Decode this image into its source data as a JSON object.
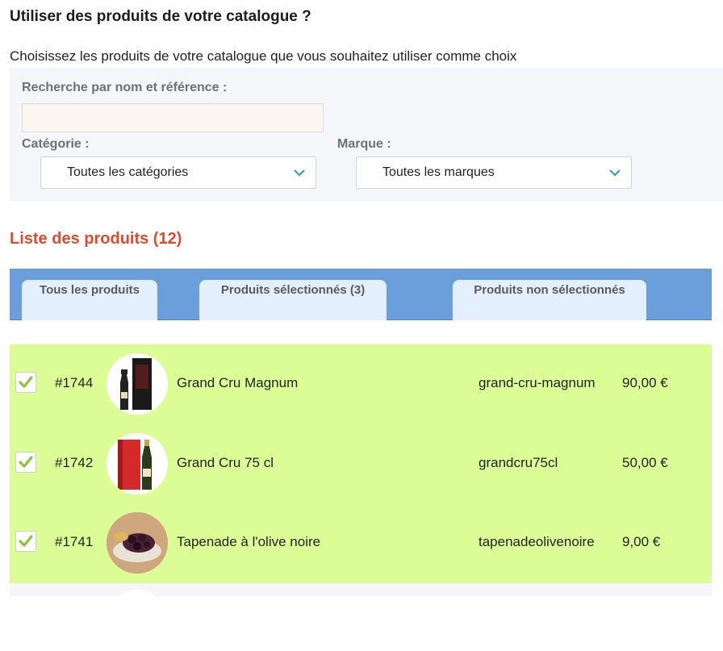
{
  "page": {
    "title": "Utiliser des produits de votre catalogue ?",
    "subtitle": "Choisissez les produits de votre catalogue que vous souhaitez utiliser comme choix"
  },
  "filters": {
    "search_label": "Recherche par nom et référence :",
    "search_value": "",
    "category_label": "Catégorie :",
    "category_value": "Toutes les catégories",
    "brand_label": "Marque :",
    "brand_value": "Toutes les marques"
  },
  "list": {
    "title": "Liste des produits (12)",
    "tabs": [
      {
        "label": "Tous les produits"
      },
      {
        "label": "Produits sélectionnés (3)"
      },
      {
        "label": "Produits non sélectionnés"
      }
    ],
    "rows": [
      {
        "id": "#1744",
        "name": "Grand Cru Magnum",
        "ref": "grand-cru-magnum",
        "price": "90,00 €",
        "checked": true,
        "image": "champagne-magnum-with-box"
      },
      {
        "id": "#1742",
        "name": "Grand Cru 75 cl",
        "ref": "grandcru75cl",
        "price": "50,00 €",
        "checked": true,
        "image": "champagne-bottle-red-box"
      },
      {
        "id": "#1741",
        "name": "Tapenade à l'olive noire",
        "ref": "tapenadeolivenoire",
        "price": "9,00 €",
        "checked": true,
        "image": "black-olive-bowl"
      }
    ]
  },
  "colors": {
    "accent_red": "#e04a2e",
    "tabbar_blue": "#6a9fdc",
    "selected_row_green": "#dcfd96",
    "check_green": "#8cc43a",
    "chevron_blue": "#3b9ac4"
  }
}
